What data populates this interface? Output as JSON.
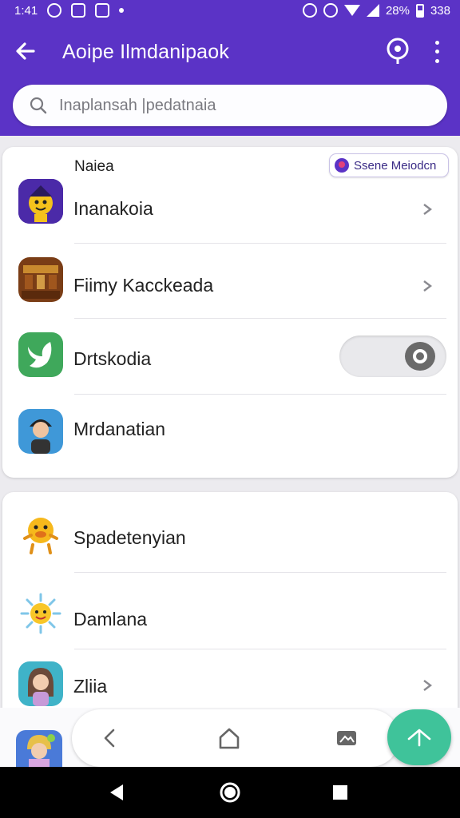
{
  "status_bar": {
    "time": "1:41",
    "battery_text": "28%",
    "extra": "338"
  },
  "app_bar": {
    "title": "Aoipe Ilmdanipaok",
    "back_icon": "arrow-left-icon",
    "pin_icon": "location-pin-icon",
    "menu_icon": "more-vert-icon"
  },
  "search": {
    "placeholder": "Inaplansah |pedatnaia",
    "icon": "search-icon"
  },
  "section1": {
    "label": "Naiea",
    "chip_label": "Ssene Meiodcn",
    "items": [
      {
        "label": "Inanakoia",
        "icon": "character-avatar-icon",
        "trailing": "chevron"
      },
      {
        "label": "Fiimy Kacckeada",
        "icon": "game-scene-icon",
        "trailing": "chevron"
      },
      {
        "label": "Drtskodia",
        "icon": "bird-logo-icon",
        "trailing": "toggle",
        "toggle_on": true
      },
      {
        "label": "Mrdanatian",
        "icon": "person-avatar-icon",
        "trailing": "none"
      }
    ]
  },
  "section2": {
    "items": [
      {
        "label": "Spadetenyian",
        "icon": "duck-sticker-icon",
        "trailing": "none"
      },
      {
        "label": "Damlana",
        "icon": "sun-sticker-icon",
        "trailing": "none"
      },
      {
        "label": "Zliia",
        "icon": "girl-avatar-icon",
        "trailing": "chevron"
      }
    ]
  },
  "bottom_dock": {
    "items": [
      "back-icon",
      "home-icon",
      "image-icon"
    ],
    "fab_icon": "arrow-up-icon"
  },
  "system_nav": [
    "back-triangle-icon",
    "home-circle-icon",
    "recents-square-icon"
  ],
  "colors": {
    "primary": "#5b33c6",
    "fab": "#3fc39a",
    "background": "#ecebef"
  }
}
